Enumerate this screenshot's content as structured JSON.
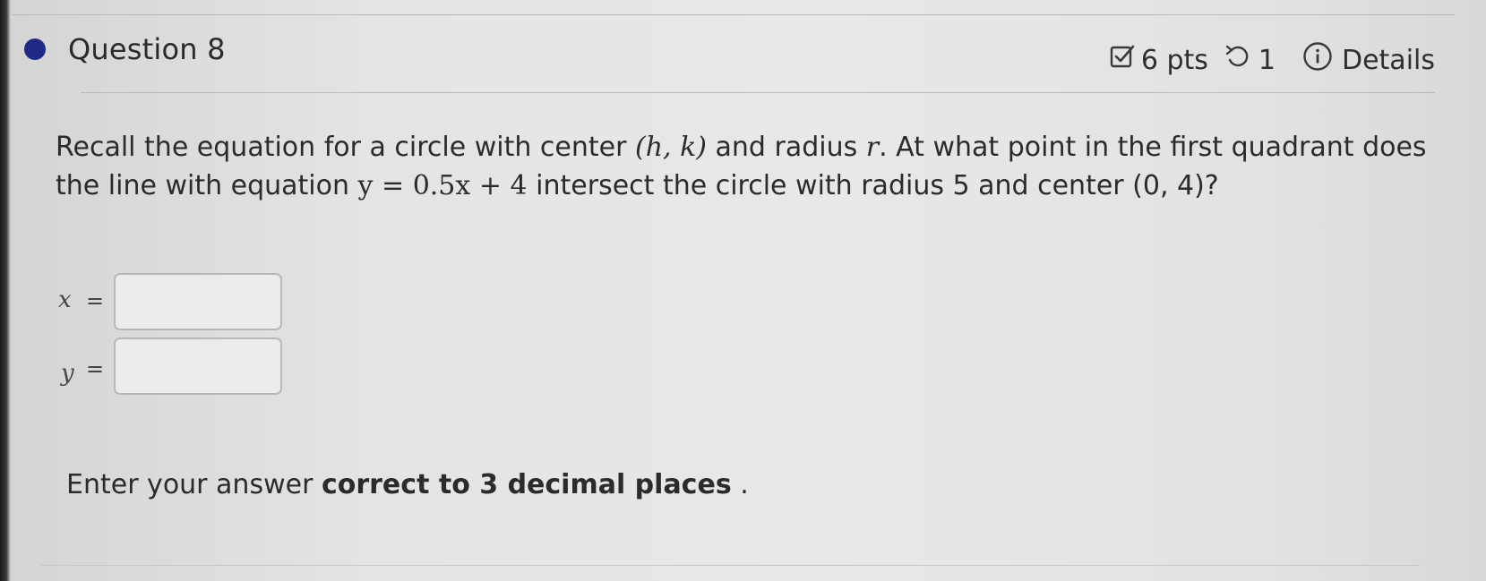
{
  "question": {
    "title": "Question 8",
    "points": "6 pts",
    "attempts": "1",
    "details_label": "Details"
  },
  "prompt": {
    "part1": "Recall the equation for a circle with center ",
    "center_symbol": "(h, k)",
    "part2": " and radius ",
    "radius_symbol": "r",
    "part3": ". At what point in the first quadrant does the line with equation ",
    "line_equation": "y = 0.5x + 4",
    "part4": " intersect the circle with radius 5 and center (0, 4)?"
  },
  "answers": [
    {
      "label": "x",
      "equals": "=",
      "value": "",
      "placeholder": ""
    },
    {
      "label": "y",
      "equals": "=",
      "value": "",
      "placeholder": ""
    }
  ],
  "instruction": {
    "prefix": "Enter your answer ",
    "emphasis": "correct to 3 decimal places",
    "suffix": " ."
  },
  "colors": {
    "question_dot": "#1f2a86",
    "background": "#e6e6e4",
    "border": "#b8b8b6"
  }
}
